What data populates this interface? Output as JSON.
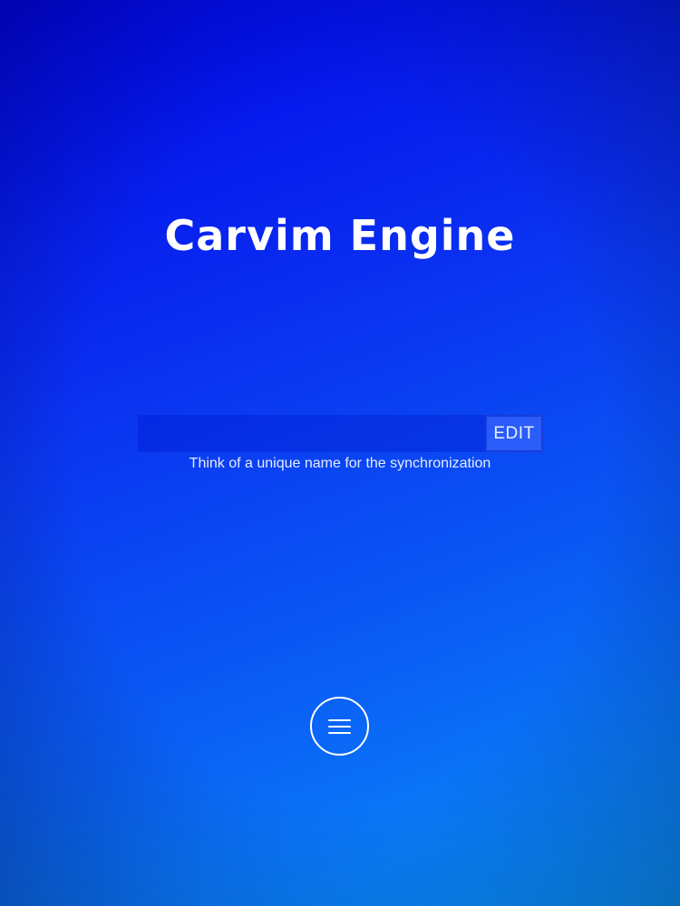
{
  "app": {
    "title": "Carvim Engine"
  },
  "sync": {
    "name_value": "",
    "name_placeholder": "",
    "edit_label": "EDIT",
    "hint": "Think of a unique name for the synchronization"
  },
  "menu": {
    "icon": "hamburger-menu-icon"
  },
  "colors": {
    "background_top": "#0004ea",
    "background_bottom": "#0a94fb",
    "text": "#ffffff"
  }
}
